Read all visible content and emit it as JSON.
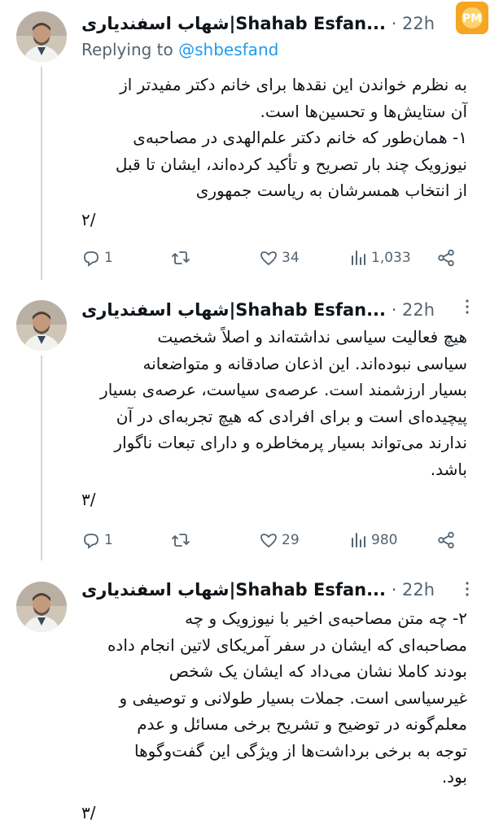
{
  "tweets": [
    {
      "name": "شهاب اسفندیاری|Shahab Esfan...",
      "time": "· 22h",
      "replying_prefix": "Replying to",
      "replying_handle": "@shbesfand",
      "body": [
        "به نظرم خواندن این نقدها برای خانم دکتر مفیدتر از",
        "آن ستایش‌ها و تحسین‌ها است.",
        "۱- همان‌طور که خانم دکتر علم‌الهدی در مصاحبه‌ی",
        "نیوزویک چند بار تصریح و تأکید کرده‌اند، ایشان تا قبل",
        "از انتخاب همسرشان به ریاست جمهوری"
      ],
      "counter": "۲/",
      "stats": {
        "replies": "1",
        "retweets": "",
        "likes": "34",
        "views": "1,033"
      }
    },
    {
      "name": "شهاب اسفندیاری|Shahab Esfan...",
      "time": "· 22h",
      "body": [
        "هیچ فعالیت سیاسی نداشته‌اند و اصلاً شخصیت",
        "سیاسی نبوده‌اند. این اذعان صادقانه و متواضعانه",
        "بسیار ارزشمند است. عرصه‌ی سیاست، عرصه‌ی بسیار",
        "پیچیده‌ای است و برای افرادی که هیچ تجربه‌ای در آن",
        "ندارند می‌تواند بسیار پرمخاطره و دارای تبعات ناگوار",
        "باشد."
      ],
      "counter": "۳/",
      "stats": {
        "replies": "1",
        "retweets": "",
        "likes": "29",
        "views": "980"
      }
    },
    {
      "name": "شهاب اسفندیاری|Shahab Esfan...",
      "time": "· 22h",
      "body": [
        "۲- چه متن مصاحبه‌ی اخیر با نیوزویک و چه",
        "مصاحبه‌ای که ایشان در سفر آمریکای لاتین انجام داده",
        "بودند کاملا نشان می‌داد که ایشان یک شخص",
        "غیرسیاسی است. جملات بسیار طولانی و توصیفی و",
        "معلم‌گونه در توضیح و تشریح برخی مسائل و عدم",
        "توجه به برخی برداشت‌ها از ویژگی این گفت‌وگوها",
        "بود."
      ],
      "counter": "۳/"
    }
  ],
  "colors": {
    "text": "#0f1419",
    "muted": "#536471",
    "link": "#1d9bf0",
    "divider": "#eff3f4"
  },
  "icons": [
    "reply-icon",
    "retweet-icon",
    "like-icon",
    "views-icon",
    "share-icon",
    "more-icon"
  ]
}
